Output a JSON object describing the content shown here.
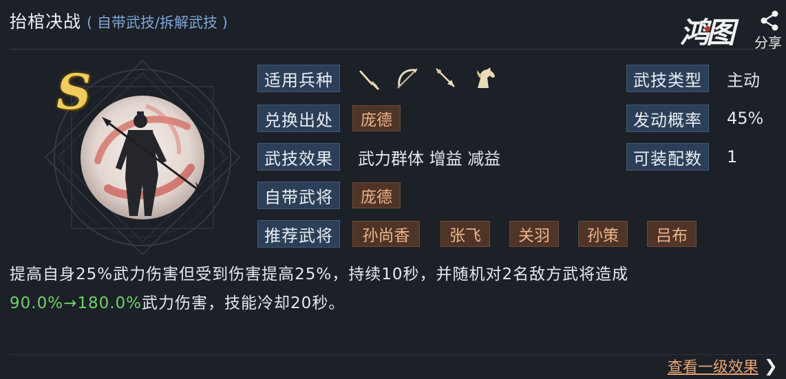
{
  "header": {
    "title": "抬棺决战",
    "subtitle": "( 自带武技/拆解武技 )"
  },
  "brand": {
    "logo_text": "鸿图",
    "share_label": "分享"
  },
  "skill": {
    "grade": "S"
  },
  "rows": {
    "troop_label": "适用兵种",
    "troop_icons": [
      "sword-icon",
      "bow-icon",
      "spear-icon",
      "horse-icon"
    ],
    "source_label": "兑换出处",
    "source_value": "庞德",
    "effect_label": "武技效果",
    "effect_value": "武力群体 增益 减益",
    "own_general_label": "自带武将",
    "own_general_value": "庞德",
    "recommend_label": "推荐武将",
    "recommend_values": [
      "孙尚香",
      "张飞",
      "关羽",
      "孙策",
      "吕布"
    ],
    "type_label": "武技类型",
    "type_value": "主动",
    "rate_label": "发动概率",
    "rate_value": "45%",
    "slots_label": "可装配数",
    "slots_value": "1"
  },
  "description": {
    "line1": "提高自身25%武力伤害但受到伤害提高25%，持续10秒，并随机对2名敌方武将造成",
    "line2_highlight": "90.0%→180.0%",
    "line2_rest": "武力伤害，技能冷却20秒。"
  },
  "footer": {
    "link_label": "查看一级效果",
    "link_arrow": "❯"
  },
  "colors": {
    "background": "#1c2027",
    "label_bg": "#2c3f58",
    "tag_bg": "#4f3527",
    "tag_text": "#f0b38a",
    "highlight": "#6fd06a",
    "grade": "#f0cd5c",
    "link": "#e8a574"
  }
}
